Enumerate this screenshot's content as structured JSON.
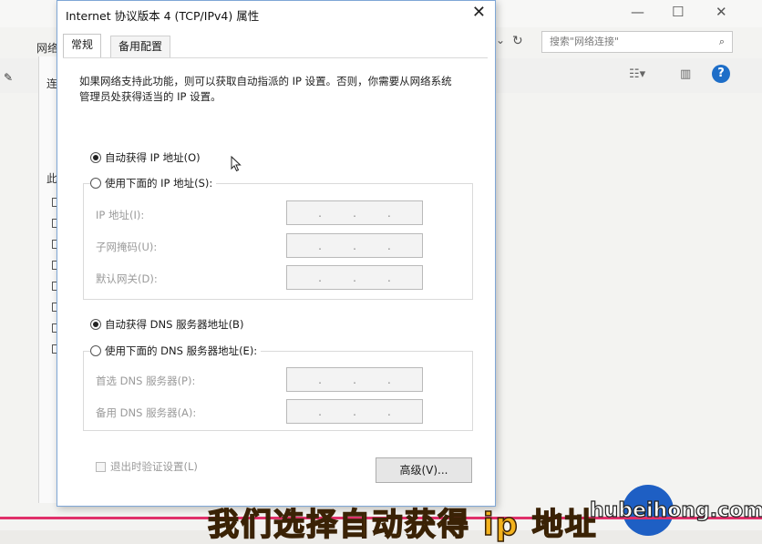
{
  "background_window": {
    "search_placeholder": "搜索\"网络连接\"",
    "left_labels": [
      "网络",
      "连",
      "此"
    ],
    "min": "—",
    "max": "☐",
    "close": "✕"
  },
  "dialog": {
    "title": "Internet 协议版本 4 (TCP/IPv4) 属性",
    "close": "✕",
    "tabs": [
      {
        "label": "常规",
        "active": true
      },
      {
        "label": "备用配置",
        "active": false
      }
    ],
    "description": "如果网络支持此功能，则可以获取自动指派的 IP 设置。否则，你需要从网络系统管理员处获得适当的 IP 设置。",
    "ip_auto": "自动获得 IP 地址(O)",
    "ip_manual": "使用下面的 IP 地址(S):",
    "ip_fields": [
      {
        "label": "IP 地址(I):"
      },
      {
        "label": "子网掩码(U):"
      },
      {
        "label": "默认网关(D):"
      }
    ],
    "dns_auto": "自动获得 DNS 服务器地址(B)",
    "dns_manual": "使用下面的 DNS 服务器地址(E):",
    "dns_fields": [
      {
        "label": "首选 DNS 服务器(P):"
      },
      {
        "label": "备用 DNS 服务器(A):"
      }
    ],
    "validate_on_exit": "退出时验证设置(L)",
    "advanced_button": "高级(V)...",
    "ip_dots": "."
  },
  "caption": "我们选择自动获得 ip 地址",
  "watermark": "hubeihong.com",
  "colors": {
    "accent": "#1e6ec8",
    "caption": "#f3b21d",
    "bar": "#e0306a"
  }
}
